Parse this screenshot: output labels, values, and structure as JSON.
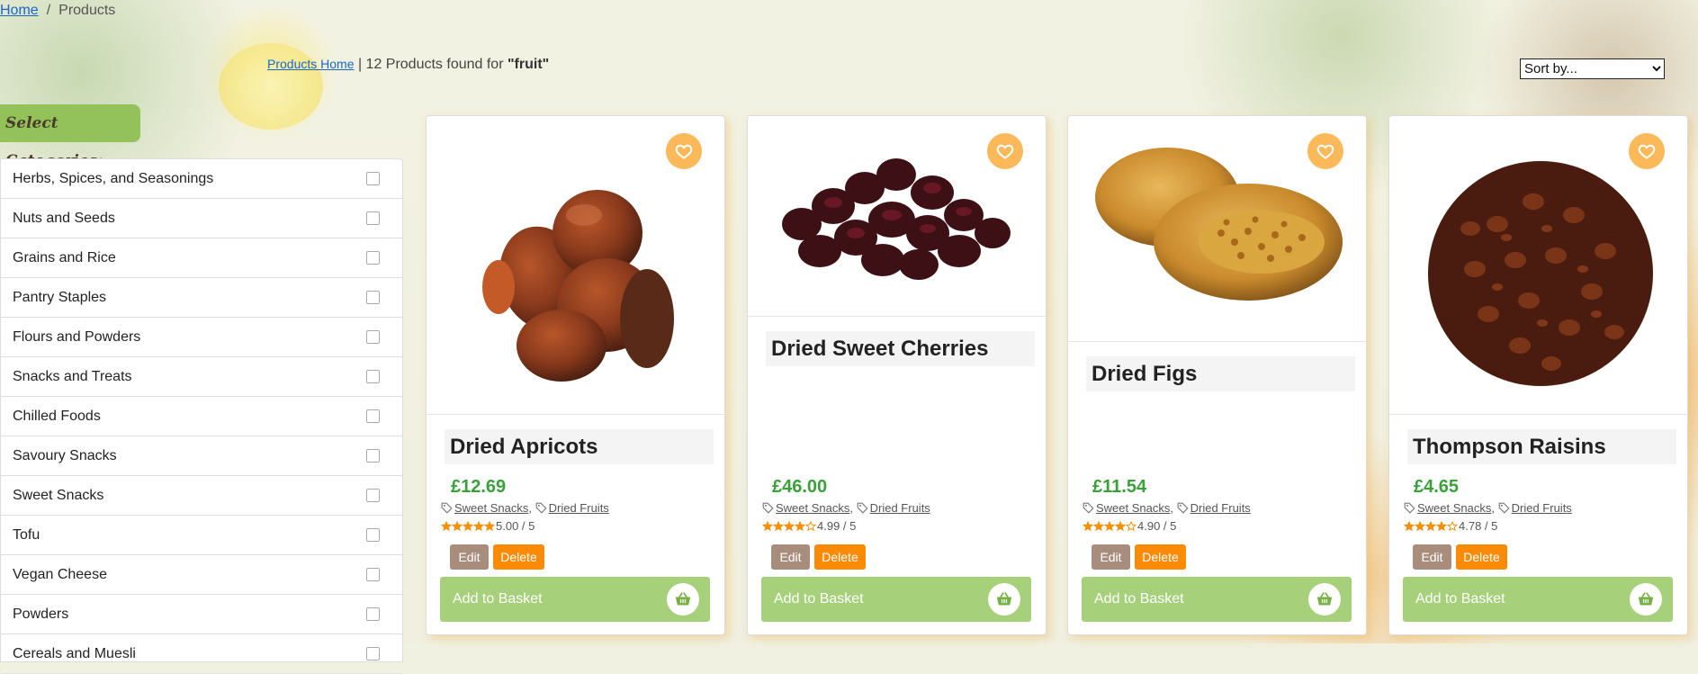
{
  "breadcrumb": {
    "home": "Home",
    "separator": "/",
    "current": "Products"
  },
  "results": {
    "link": "Products Home",
    "text": "| 12 Products found for ",
    "query": "\"fruit\""
  },
  "sort": {
    "selected": "Sort by..."
  },
  "categories": {
    "heading": "Select Categories:",
    "items": [
      {
        "label": "Herbs, Spices, and Seasonings"
      },
      {
        "label": "Nuts and Seeds"
      },
      {
        "label": "Grains and Rice"
      },
      {
        "label": "Pantry Staples"
      },
      {
        "label": "Flours and Powders"
      },
      {
        "label": "Snacks and Treats"
      },
      {
        "label": "Chilled Foods"
      },
      {
        "label": "Savoury Snacks"
      },
      {
        "label": "Sweet Snacks"
      },
      {
        "label": "Tofu"
      },
      {
        "label": "Vegan Cheese"
      },
      {
        "label": "Powders"
      },
      {
        "label": "Cereals and Muesli"
      }
    ]
  },
  "products": [
    {
      "name": "Dried Apricots",
      "price": "£12.69",
      "tag1": "Sweet Snacks",
      "tag_sep": ",",
      "tag2": "Dried Fruits",
      "stars": 5,
      "rating": "5.00 / 5",
      "edit": "Edit",
      "delete": "Delete",
      "basket": "Add to Basket"
    },
    {
      "name": "Dried Sweet Cherries",
      "price": "£46.00",
      "tag1": "Sweet Snacks",
      "tag_sep": ",",
      "tag2": "Dried Fruits",
      "stars": 4,
      "rating": "4.99 / 5",
      "edit": "Edit",
      "delete": "Delete",
      "basket": "Add to Basket"
    },
    {
      "name": "Dried Figs",
      "price": "£11.54",
      "tag1": "Sweet Snacks",
      "tag_sep": ",",
      "tag2": "Dried Fruits",
      "stars": 4,
      "rating": "4.90 / 5",
      "edit": "Edit",
      "delete": "Delete",
      "basket": "Add to Basket"
    },
    {
      "name": "Thompson Raisins",
      "price": "£4.65",
      "tag1": "Sweet Snacks",
      "tag_sep": ",",
      "tag2": "Dried Fruits",
      "stars": 4,
      "rating": "4.78 / 5",
      "edit": "Edit",
      "delete": "Delete",
      "basket": "Add to Basket"
    }
  ],
  "colors": {
    "accent_green": "#93c25a",
    "basket_green": "#a7d07a",
    "price_green": "#3aa03a",
    "fav_orange": "#fbb95a",
    "delete_orange": "#fb8b07",
    "edit_brown": "#a88c7c",
    "star_orange": "#f5900a"
  },
  "icons": {
    "favorite": "heart-icon",
    "basket": "basket-icon",
    "tag": "tag-icon",
    "star": "star-icon"
  }
}
